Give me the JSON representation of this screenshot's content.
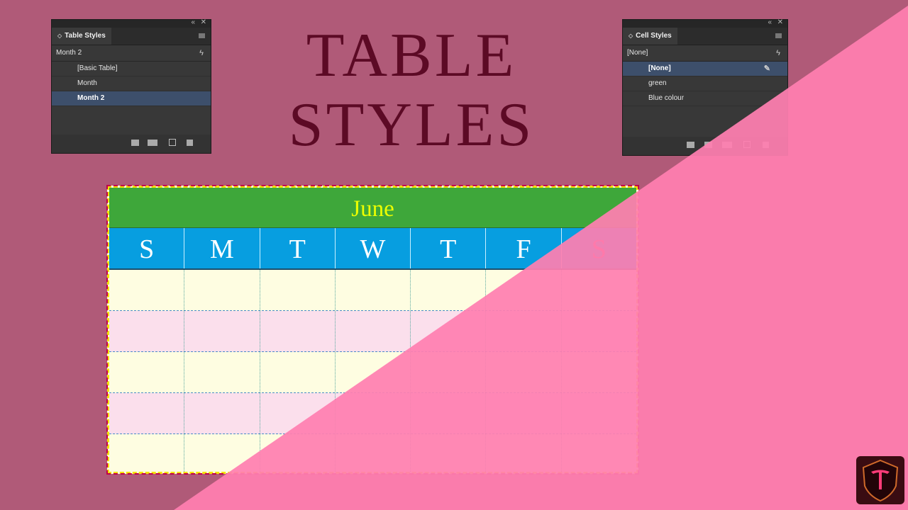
{
  "title": {
    "line1": "TABLE",
    "line2": "STYLES"
  },
  "table_styles_panel": {
    "tab": "Table Styles",
    "current": "Month 2",
    "items": [
      {
        "label": "[Basic Table]",
        "selected": false
      },
      {
        "label": "Month",
        "selected": false
      },
      {
        "label": "Month 2",
        "selected": true
      }
    ]
  },
  "cell_styles_panel": {
    "tab": "Cell Styles",
    "current": "[None]",
    "items": [
      {
        "label": "[None]",
        "selected": true
      },
      {
        "label": "green",
        "selected": false
      },
      {
        "label": "Blue colour",
        "selected": false
      }
    ]
  },
  "calendar": {
    "month": "June",
    "days": [
      "S",
      "M",
      "T",
      "W",
      "T",
      "F",
      "S"
    ],
    "weeks": 5
  },
  "colors": {
    "background": "#b05a78",
    "overlay_pink": "#ff7fb0",
    "title": "#5c0a25",
    "month_header": "#3ea73a",
    "month_text": "#ecff00",
    "day_header": "#079ee0",
    "cream_row": "#fefde1",
    "pink_row": "#fbdfec",
    "panel_selected": "#3d4f6b"
  },
  "icons": {
    "bolt": "lightning-bolt-icon",
    "folder": "folder-icon",
    "clear_overrides": "clear-overrides-icon",
    "new_style": "new-style-icon",
    "delete": "trash-icon",
    "logo": "channel-logo-icon"
  }
}
